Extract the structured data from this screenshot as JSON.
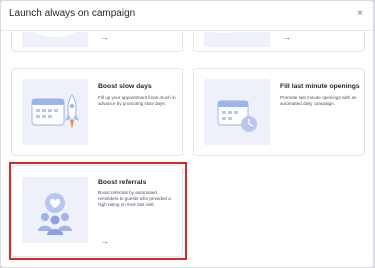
{
  "modal": {
    "title": "Launch always on campaign"
  },
  "cards": [
    {
      "id": "top-left-card",
      "title": "",
      "desc": "",
      "arrow": "→"
    },
    {
      "id": "top-right-card",
      "title": "",
      "desc": "",
      "arrow": "→"
    },
    {
      "id": "boost-slow-days",
      "title": "Boost slow days",
      "desc": "Fill up your appointment book much in advance by promoting slow days.",
      "arrow": "→"
    },
    {
      "id": "fill-last-minute",
      "title": "Fill last minute openings",
      "desc": "Promote last minute openings with an automated daily campaign.",
      "arrow": "→"
    },
    {
      "id": "boost-referrals",
      "title": "Boost referrals",
      "desc": "Boost referrals by automated reminders to guests who provided a high rating on their last visit.",
      "arrow": "→"
    }
  ],
  "close_glyph": "×",
  "colors": {
    "accent": "#2f73d8",
    "highlight": "#d62a2a",
    "art_bg": "#eef0fa"
  }
}
